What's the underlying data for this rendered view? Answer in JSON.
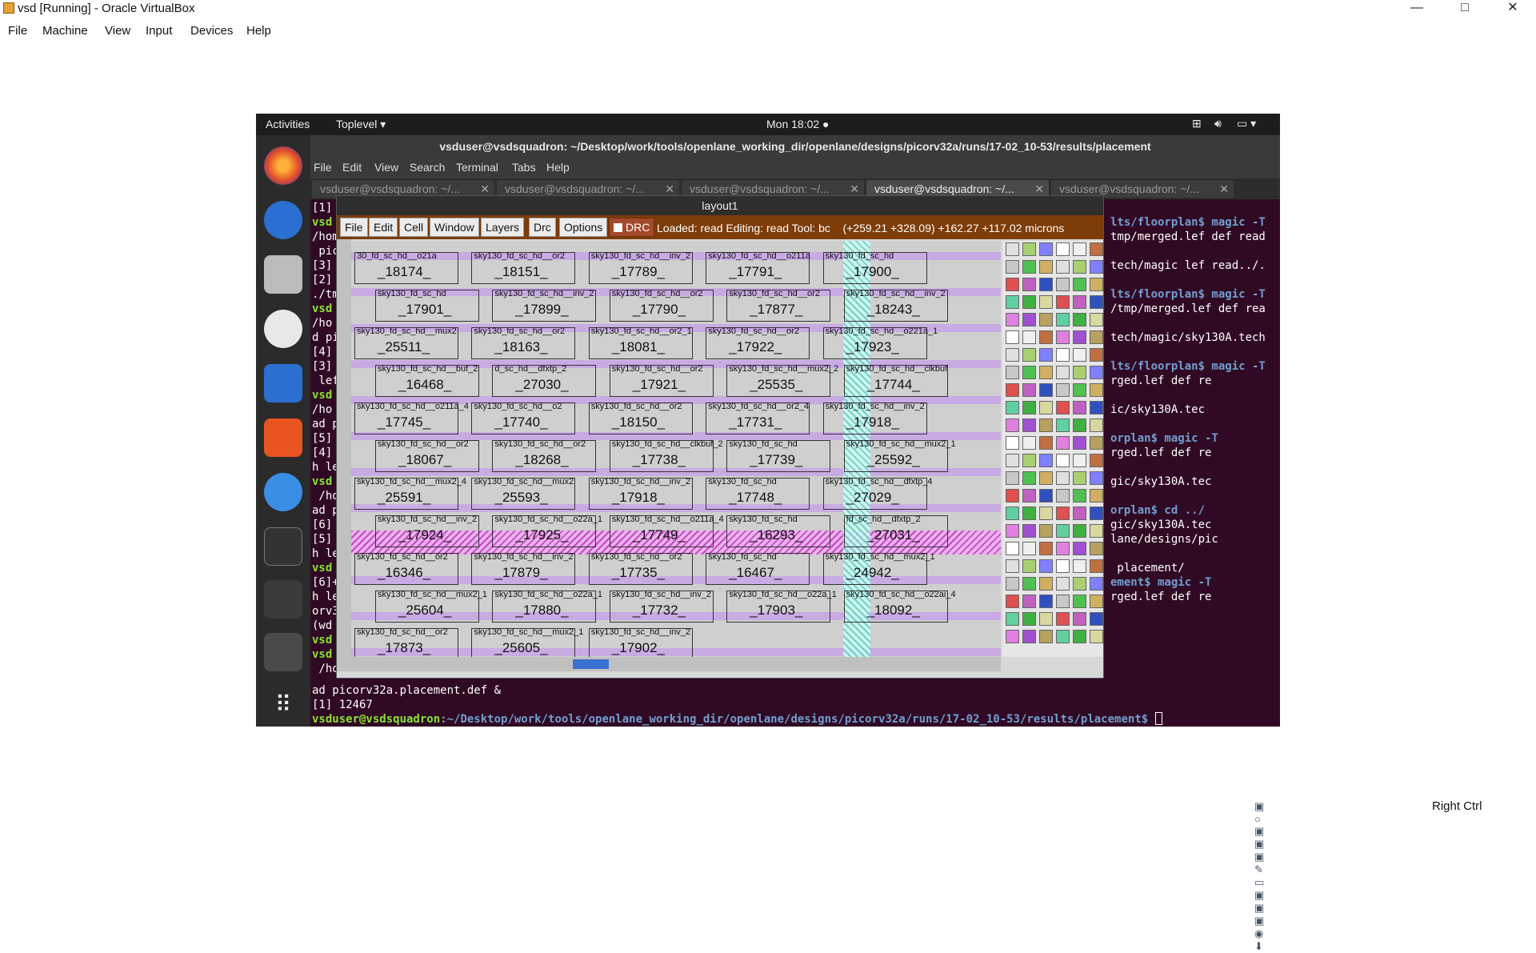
{
  "window": {
    "title": "vsd [Running] - Oracle VirtualBox",
    "controls": [
      "—",
      "□",
      "✕"
    ]
  },
  "host_menu": [
    "File",
    "Machine",
    "View",
    "Input",
    "Devices",
    "Help"
  ],
  "gnome_topbar": {
    "activities": "Activities",
    "app": "Toplevel ▾",
    "clock": "Mon 18:02 ●"
  },
  "terminal": {
    "title": "vsduser@vsdsquadron: ~/Desktop/work/tools/openlane_working_dir/openlane/designs/picorv32a/runs/17-02_10-53/results/placement",
    "menu": [
      "File",
      "Edit",
      "View",
      "Search",
      "Terminal",
      "Tabs",
      "Help"
    ],
    "tabs": [
      {
        "label": "vsduser@vsdsquadron: ~/...",
        "active": false
      },
      {
        "label": "vsduser@vsdsquadron: ~/...",
        "active": false
      },
      {
        "label": "vsduser@vsdsquadron: ~/...",
        "active": false
      },
      {
        "label": "vsduser@vsdsquadron: ~/...",
        "active": true
      },
      {
        "label": "vsduser@vsdsquadron: ~/...",
        "active": false
      }
    ],
    "left_lines": [
      "[1]",
      "vsd",
      "/hom",
      " pic",
      "[3]",
      "[2]",
      "./tm",
      "vsd",
      "/ho",
      "d pi",
      "[4]",
      "[3]",
      " lef",
      "vsd",
      "/ho",
      "ad p",
      "[5]",
      "[4]",
      "h le",
      "vsd",
      " /ho",
      "ad p",
      "[6]",
      "[5]",
      "h le",
      "vsd",
      "[6]+",
      "h le",
      "orv3",
      "(wd",
      "vsd",
      "vsd",
      " /ho"
    ],
    "right_lines": [
      {
        "text": "lts/floorplan$ magic -T",
        "color": "b"
      },
      {
        "text": "tmp/merged.lef def read",
        "color": "w"
      },
      {
        "text": "",
        "color": "w"
      },
      {
        "text": "tech/magic lef read../.",
        "color": "w"
      },
      {
        "text": "",
        "color": "w"
      },
      {
        "text": "lts/floorplan$ magic -T",
        "color": "b"
      },
      {
        "text": "/tmp/merged.lef def rea",
        "color": "w"
      },
      {
        "text": "",
        "color": "w"
      },
      {
        "text": "tech/magic/sky130A.tech",
        "color": "w"
      },
      {
        "text": "",
        "color": "w"
      },
      {
        "text": "lts/floorplan$ magic -T",
        "color": "b"
      },
      {
        "text": "rged.lef def re",
        "color": "w"
      },
      {
        "text": "",
        "color": "w"
      },
      {
        "text": "ic/sky130A.tec",
        "color": "w"
      },
      {
        "text": "",
        "color": "w"
      },
      {
        "text": "orplan$ magic -T",
        "color": "b"
      },
      {
        "text": "rged.lef def re",
        "color": "w"
      },
      {
        "text": "",
        "color": "w"
      },
      {
        "text": "gic/sky130A.tec",
        "color": "w"
      },
      {
        "text": "",
        "color": "w"
      },
      {
        "text": "orplan$ cd ../",
        "color": "b"
      },
      {
        "text": "gic/sky130A.tec",
        "color": "w"
      },
      {
        "text": "lane/designs/pic",
        "color": "w"
      },
      {
        "text": "",
        "color": "w"
      },
      {
        "text": " placement/",
        "color": "w"
      },
      {
        "text": "ement$ magic -T",
        "color": "b"
      },
      {
        "text": "rged.lef def re",
        "color": "w"
      }
    ],
    "bottom_lines": [
      {
        "text": "ad picorv32a.placement.def &",
        "color": "w"
      },
      {
        "text": "[1] 12467",
        "color": "w"
      }
    ],
    "prompt_user": "vsduser@vsdsquadron",
    "prompt_path": ":~/Desktop/work/tools/openlane_working_dir/openlane/designs/picorv32a/runs/17-02_10-53/results/placement$ "
  },
  "magic": {
    "title": "layout1",
    "menu": [
      "File",
      "Edit",
      "Cell",
      "Window",
      "Layers",
      "Drc",
      "Options"
    ],
    "drc_label": "DRC",
    "status": "Loaded: read Editing: read Tool: bc    (+259.21 +328.09) +162.27 +117.02 microns",
    "cells": [
      {
        "lab": "30_fd_sc_hd__o21a",
        "num": "_18174_"
      },
      {
        "lab": "sky130_fd_sc_hd__or2",
        "num": "_18151_"
      },
      {
        "lab": "sky130_fd_sc_hd__inv_2",
        "num": "_17789_"
      },
      {
        "lab": "sky130_fd_sc_hd__o211a",
        "num": "_17791_"
      },
      {
        "lab": "sky130_fd_sc_hd",
        "num": "_17900_"
      },
      {
        "lab": "sky130_fd_sc_hd",
        "num": "_17901_"
      },
      {
        "lab": "sky130_fd_sc_hd__inv_2",
        "num": "_17899_"
      },
      {
        "lab": "sky130_fd_sc_hd__or2",
        "num": "_17790_"
      },
      {
        "lab": "sky130_fd_sc_hd__or2",
        "num": "_17877_"
      },
      {
        "lab": "sky130_fd_sc_hd__inv_2",
        "num": "_18243_"
      },
      {
        "lab": "sky130_fd_sc_hd__mux2",
        "num": "_25511_"
      },
      {
        "lab": "sky130_fd_sc_hd__or2",
        "num": "_18163_"
      },
      {
        "lab": "sky130_fd_sc_hd__or2_1",
        "num": "_18081_"
      },
      {
        "lab": "sky130_fd_sc_hd__or2",
        "num": "_17922_"
      },
      {
        "lab": "sky130_fd_sc_hd__o221a_1",
        "num": "_17923_"
      },
      {
        "lab": "sky130_fd_sc_hd__buf_2",
        "num": "_16468_"
      },
      {
        "lab": "d_sc_hd__dfxtp_2",
        "num": "_27030_"
      },
      {
        "lab": "sky130_fd_sc_hd__or2",
        "num": "_17921_"
      },
      {
        "lab": "sky130_fd_sc_hd__mux2_2",
        "num": "_25535_"
      },
      {
        "lab": "sky130_fd_sc_hd__clkbuf",
        "num": "_17744_"
      },
      {
        "lab": "sky130_fd_sc_hd__o211a_4",
        "num": "_17745_"
      },
      {
        "lab": "sky130_fd_sc_hd__o2",
        "num": "_17740_"
      },
      {
        "lab": "sky130_fd_sc_hd__or2",
        "num": "_18150_"
      },
      {
        "lab": "sky130_fd_sc_hd__or2_4",
        "num": "_17731_"
      },
      {
        "lab": "sky130_fd_sc_hd__inv_2",
        "num": "_17918_"
      },
      {
        "lab": "sky130_fd_sc_hd__or2",
        "num": "_18067_"
      },
      {
        "lab": "sky130_fd_sc_hd__or2",
        "num": "_18268_"
      },
      {
        "lab": "sky130_fd_sc_hd__clkbuf_2",
        "num": "_17738_"
      },
      {
        "lab": "sky130_fd_sc_hd",
        "num": "_17739_"
      },
      {
        "lab": "sky130_fd_sc_hd__mux2_1",
        "num": "_25592_"
      },
      {
        "lab": "sky130_fd_sc_hd__mux2_4",
        "num": "_25591_"
      },
      {
        "lab": "sky130_fd_sc_hd__mux2",
        "num": "_25593_"
      },
      {
        "lab": "sky130_fd_sc_hd__inv_2",
        "num": "_17918_"
      },
      {
        "lab": "sky130_fd_sc_hd",
        "num": "_17748_"
      },
      {
        "lab": "sky130_fd_sc_hd__dfxtp_4",
        "num": "_27029_"
      },
      {
        "lab": "sky130_fd_sc_hd__inv_2",
        "num": "_17924_"
      },
      {
        "lab": "sky130_fd_sc_hd__o22a_1",
        "num": "_17925_"
      },
      {
        "lab": "sky130_fd_sc_hd__o211a_4",
        "num": "_17749_"
      },
      {
        "lab": "sky130_fd_sc_hd",
        "num": "_16293_"
      },
      {
        "lab": "fd_sc_hd__dfxtp_2",
        "num": "_27031_"
      },
      {
        "lab": "sky130_fd_sc_hd__or2",
        "num": "_16346_"
      },
      {
        "lab": "sky130_fd_sc_hd__inv_2",
        "num": "_17879_"
      },
      {
        "lab": "sky130_fd_sc_hd__or2",
        "num": "_17735_"
      },
      {
        "lab": "sky130_fd_sc_hd",
        "num": "_16467_"
      },
      {
        "lab": "sky130_fd_sc_hd__mux2_1",
        "num": "_24942_"
      },
      {
        "lab": "sky130_fd_sc_hd__mux2_1",
        "num": "_25604_"
      },
      {
        "lab": "sky130_fd_sc_hd__o22a_1",
        "num": "_17880_"
      },
      {
        "lab": "sky130_fd_sc_hd__inv_2",
        "num": "_17732_"
      },
      {
        "lab": "sky130_fd_sc_hd__o22a_1",
        "num": "_17903_"
      },
      {
        "lab": "sky130_fd_sc_hd__o22ai_4",
        "num": "_18092_"
      },
      {
        "lab": "sky130_fd_sc_hd__or2",
        "num": "_17873_"
      },
      {
        "lab": "sky130_fd_sc_hd__mux2_1",
        "num": "_25605_"
      },
      {
        "lab": "sky130_fd_sc_hd__inv_2",
        "num": "_17902_"
      }
    ]
  },
  "tray": {
    "right_ctrl": "Right Ctrl"
  },
  "colors": {
    "terminal_bg": "#300a24",
    "magic_bar": "#7d3c08",
    "rail": "#c8a5e8"
  }
}
